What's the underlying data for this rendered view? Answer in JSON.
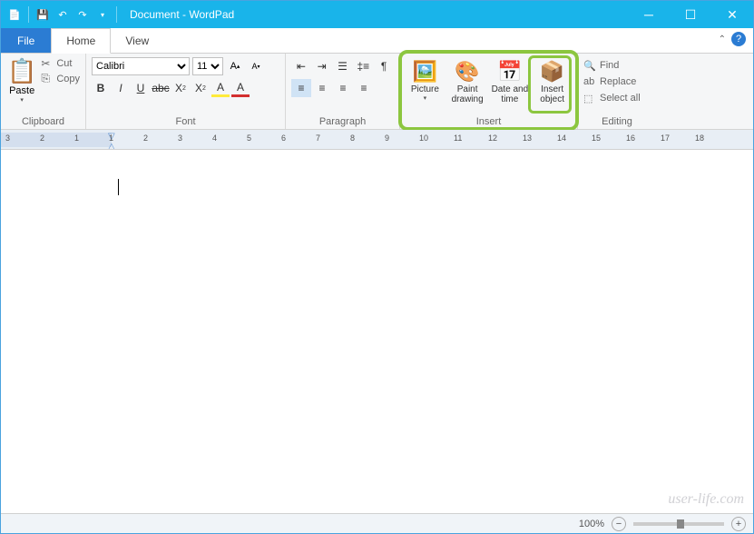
{
  "window": {
    "title": "Document - WordPad",
    "minimize": "─",
    "maximize": "☐",
    "close": "✕"
  },
  "tabs": {
    "file": "File",
    "home": "Home",
    "view": "View"
  },
  "clipboard": {
    "paste": "Paste",
    "cut": "Cut",
    "copy": "Copy",
    "label": "Clipboard"
  },
  "font": {
    "name": "Calibri",
    "size": "11",
    "label": "Font"
  },
  "paragraph": {
    "label": "Paragraph"
  },
  "insert": {
    "picture": "Picture",
    "paint": "Paint drawing",
    "datetime": "Date and time",
    "object": "Insert object",
    "label": "Insert"
  },
  "editing": {
    "find": "Find",
    "replace": "Replace",
    "selectall": "Select all",
    "label": "Editing"
  },
  "status": {
    "zoom": "100%"
  },
  "watermark": "user-life.com",
  "ruler": [
    "3",
    "2",
    "1",
    "1",
    "2",
    "3",
    "4",
    "5",
    "6",
    "7",
    "8",
    "9",
    "10",
    "11",
    "12",
    "13",
    "14",
    "15",
    "16",
    "17",
    "18"
  ]
}
